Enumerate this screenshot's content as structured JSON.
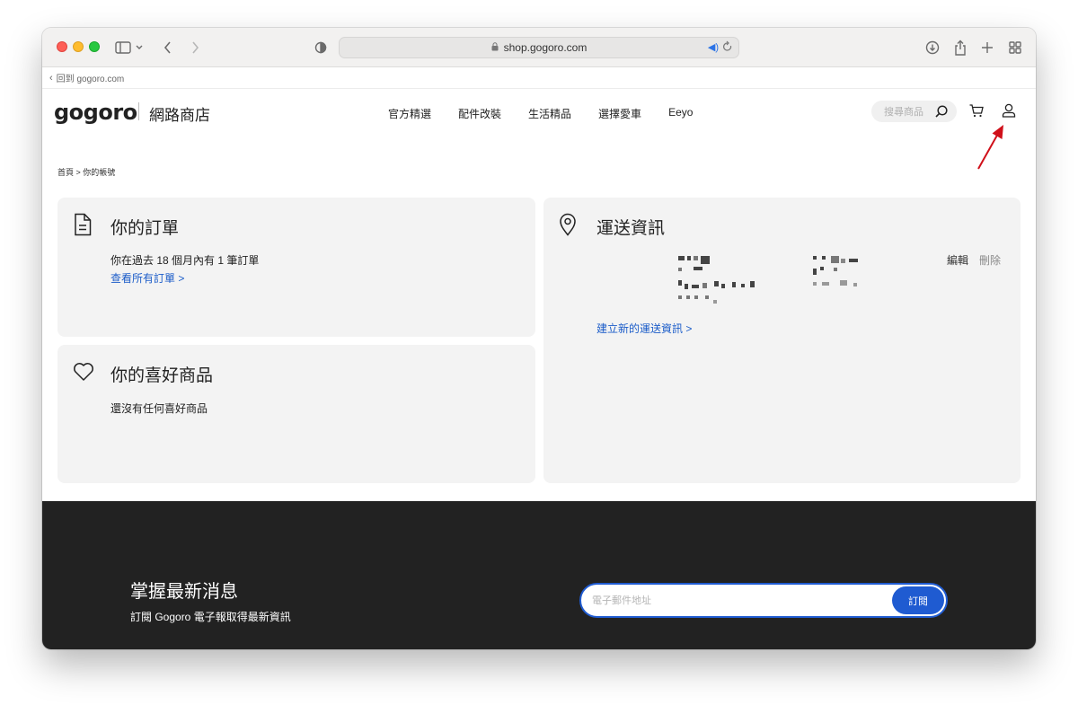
{
  "browser": {
    "url": "shop.gogoro.com",
    "back_link": "回到 gogoro.com"
  },
  "header": {
    "logo": "gogoro",
    "shop_title": "網路商店",
    "nav": [
      "官方精選",
      "配件改裝",
      "生活精品",
      "選擇愛車",
      "Eeyo"
    ],
    "search_placeholder": "搜尋商品"
  },
  "breadcrumb": "首頁 > 你的帳號",
  "orders": {
    "title": "你的訂單",
    "summary": "你在過去 18 個月內有 1 筆訂單",
    "link": "查看所有訂單 >"
  },
  "favorites": {
    "title": "你的喜好商品",
    "empty_text": "還沒有任何喜好商品"
  },
  "shipping": {
    "title": "運送資訊",
    "edit": "編輯",
    "delete": "刪除",
    "new_link": "建立新的運送資訊 >"
  },
  "footer": {
    "title": "掌握最新消息",
    "subtitle": "訂閱 Gogoro 電子報取得最新資訊",
    "email_placeholder": "電子郵件地址",
    "subscribe": "訂閱"
  },
  "colors": {
    "link": "#1c5dc9",
    "accent": "#1f5bd1",
    "footer_bg": "#222222",
    "annotation": "#d0101a"
  }
}
